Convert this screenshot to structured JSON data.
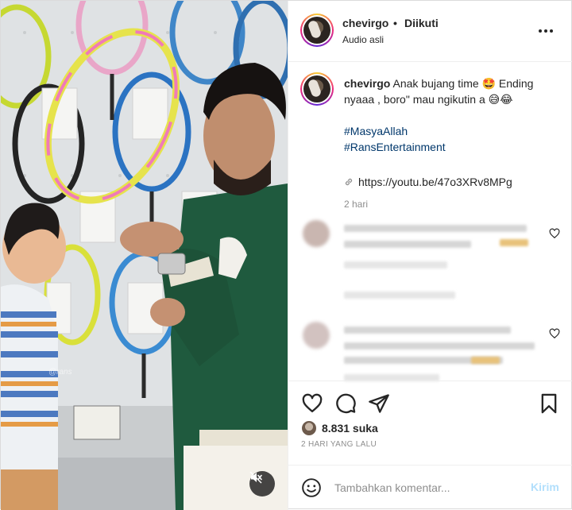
{
  "post": {
    "username": "chevirgo",
    "separator": "•",
    "follow_status": "Diikuti",
    "audio": "Audio asli",
    "watermark": "@rans",
    "caption": {
      "username": "chevirgo",
      "text": "Anak bujang time 🤩 Ending nyaaa , boro\" mau ngikutin a 😅😂",
      "hashtags": [
        "#MasyaAllah",
        "#RansEntertainment"
      ],
      "link": "https://youtu.be/47o3XRv8MPg",
      "time": "2 hari"
    },
    "likes": "8.831 suka",
    "date": "2 HARI YANG LALU"
  },
  "comment_box": {
    "placeholder": "Tambahkan komentar...",
    "post_label": "Kirim"
  },
  "icons": {
    "more": "more-horizontal-icon",
    "like": "heart-icon",
    "comment": "comment-icon",
    "share": "send-icon",
    "save": "bookmark-icon",
    "emoji": "emoji-icon",
    "mute": "speaker-muted-icon",
    "link": "link-icon"
  },
  "colors": {
    "hashtag": "#00376b",
    "post_button": "#b2dffc",
    "secondary_text": "#8e8e8e"
  }
}
